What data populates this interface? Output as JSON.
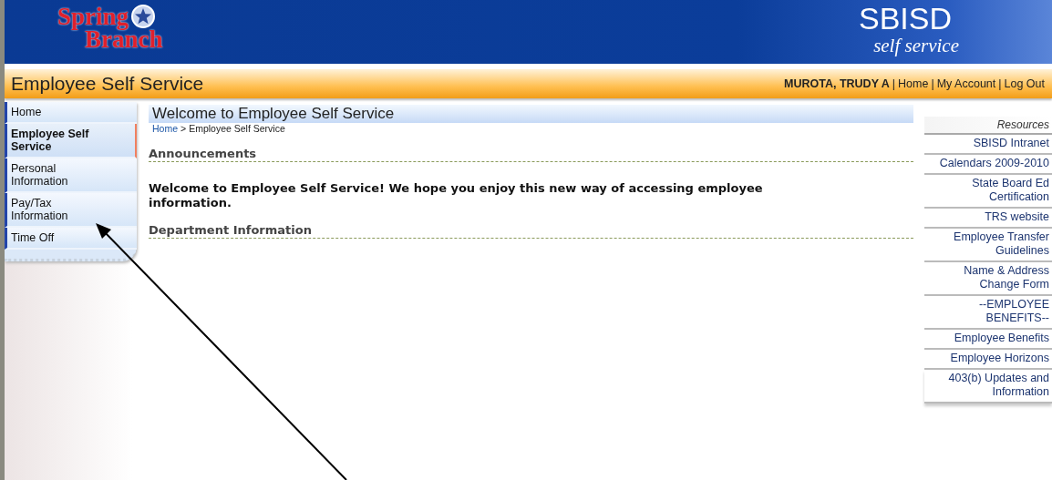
{
  "header": {
    "logo_line_1": "Spring",
    "logo_line_2": "Branch",
    "brand": "SBISD",
    "brand_sub": "self service"
  },
  "title_bar": {
    "title": "Employee Self Service",
    "user": "MUROTA, TRUDY A",
    "separator": "|",
    "links": [
      "Home",
      "My Account",
      "Log Out"
    ]
  },
  "sidebar": {
    "items": [
      {
        "label": "Home",
        "selected": false
      },
      {
        "label": "Employee Self Service",
        "selected": true
      },
      {
        "label": "Personal Information",
        "selected": false
      },
      {
        "label": "Pay/Tax Information",
        "selected": false
      },
      {
        "label": "Time Off",
        "selected": false
      }
    ]
  },
  "main": {
    "heading": "Welcome to Employee Self Service",
    "breadcrumb": {
      "link": "Home",
      "separator": ">",
      "current": "Employee Self Service"
    },
    "sections": [
      {
        "title": "Announcements",
        "body": "Welcome to Employee Self Service! We hope you enjoy this new way of accessing employee information."
      },
      {
        "title": "Department Information"
      }
    ]
  },
  "resources": {
    "title": "Resources",
    "links": [
      "SBISD Intranet",
      "Calendars 2009-2010",
      "State Board Ed Certification",
      "TRS website",
      "Employee Transfer Guidelines",
      "Name & Address Change Form",
      "--EMPLOYEE BENEFITS--",
      "Employee Benefits",
      "Employee Horizons",
      "403(b) Updates and Information"
    ]
  }
}
